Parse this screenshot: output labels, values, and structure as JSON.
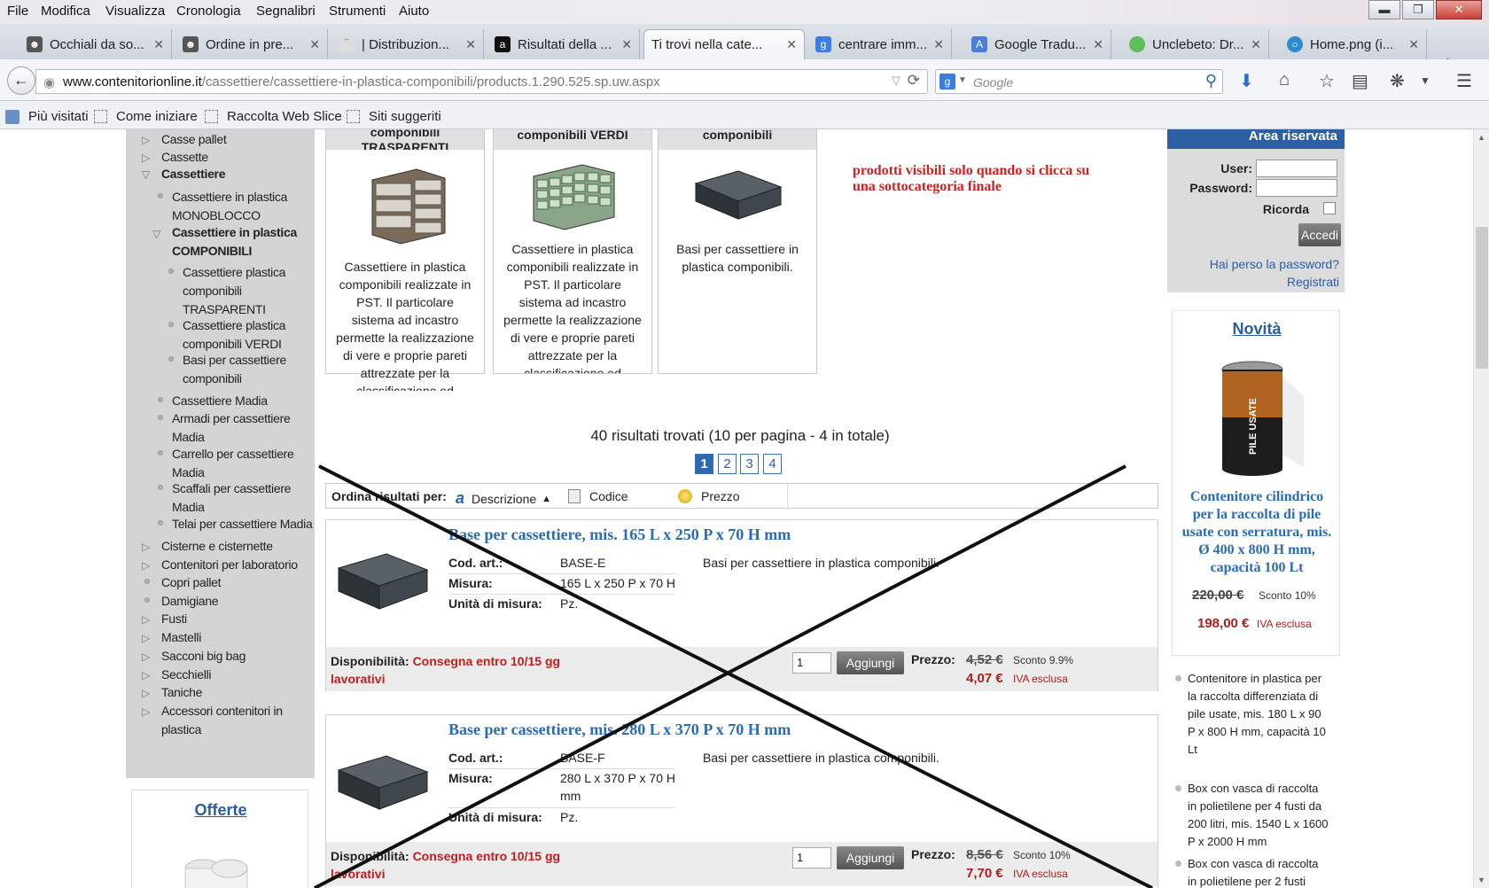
{
  "menubar": {
    "items": [
      "File",
      "Modifica",
      "Visualizza",
      "Cronologia",
      "Segnalibri",
      "Strumenti",
      "Aiuto"
    ]
  },
  "tabs": [
    {
      "label": "Occhiali da so...",
      "icon": "face-icon"
    },
    {
      "label": "Ordine in pre...",
      "icon": "face-icon"
    },
    {
      "label": "| Distribuzion...",
      "icon": "page-icon"
    },
    {
      "label": "Risultati della ...",
      "icon": "amazon-icon"
    },
    {
      "label": "Ti trovi nella cate...",
      "icon": "page-icon",
      "active": true
    },
    {
      "label": "centrare imm...",
      "icon": "google-icon"
    },
    {
      "label": "Google Tradu...",
      "icon": "translate-icon"
    },
    {
      "label": "Unclebeto: Dr...",
      "icon": "cloud-icon"
    },
    {
      "label": "Home.png (i...",
      "icon": "globe-icon"
    }
  ],
  "nav": {
    "url_domain": "www.contenitorionline.it",
    "url_path": "/cassettiere/cassettiere-in-plastica-componibili/products.1.290.525.sp.uw.aspx",
    "search_placeholder": "Google"
  },
  "bookmarks": [
    "Più visitati",
    "Come iniziare",
    "Raccolta Web Slice",
    "Siti suggeriti"
  ],
  "sidebar": {
    "items": [
      {
        "label": "Casse pallet",
        "type": "arrow"
      },
      {
        "label": "Cassette",
        "type": "arrow"
      },
      {
        "label": "Cassettiere",
        "type": "open",
        "selected": true
      },
      {
        "label": "Cassettiere in plastica MONOBLOCCO",
        "type": "dot"
      },
      {
        "label": "Cassettiere in plastica COMPONIBILI",
        "type": "open",
        "selected": true
      },
      {
        "label": "Cassettiere plastica componibili TRASPARENTI",
        "type": "dot"
      },
      {
        "label": "Cassettiere plastica componibili VERDI",
        "type": "dot"
      },
      {
        "label": "Basi per cassettiere componibili",
        "type": "dot"
      },
      {
        "label": "Cassettiere Madia",
        "type": "dot"
      },
      {
        "label": "Armadi per cassettiere Madia",
        "type": "dot"
      },
      {
        "label": "Carrello per cassettiere Madia",
        "type": "dot"
      },
      {
        "label": "Scaffali per cassettiere Madia",
        "type": "dot"
      },
      {
        "label": "Telai per cassettiere Madia",
        "type": "dot"
      },
      {
        "label": "Cisterne e cisternette",
        "type": "arrow"
      },
      {
        "label": "Contenitori per laboratorio",
        "type": "arrow"
      },
      {
        "label": "Copri pallet",
        "type": "dot"
      },
      {
        "label": "Damigiane",
        "type": "dot"
      },
      {
        "label": "Fusti",
        "type": "arrow"
      },
      {
        "label": "Mastelli",
        "type": "arrow"
      },
      {
        "label": "Sacconi big bag",
        "type": "arrow"
      },
      {
        "label": "Secchielli",
        "type": "arrow"
      },
      {
        "label": "Taniche",
        "type": "arrow"
      },
      {
        "label": "Accessori contenitori in plastica",
        "type": "arrow"
      }
    ],
    "offerte": "Offerte"
  },
  "subcategories": [
    {
      "title": "componibili TRASPARENTI",
      "desc": "Cassettiere in plastica componibili realizzate in PST. Il particolare sistema ad incastro permette la realizzazione di vere e proprie pareti attrezzate per la classificazione ed organizzazione di parti di"
    },
    {
      "title": "componibili VERDI",
      "desc": "Cassettiere in plastica componibili realizzate in PST. Il particolare sistema ad incastro permette la realizzazione di vere e proprie pareti attrezzate per la classificazione ed organizzazione di parti di"
    },
    {
      "title": "componibili",
      "desc": "Basi per cassettiere in plastica componibili."
    }
  ],
  "annotation": "prodotti visibili solo quando si clicca su una sottocategoria finale",
  "results": {
    "summary": "40 risultati trovati (10 per pagina - 4 in totale)",
    "pages": [
      "1",
      "2",
      "3",
      "4"
    ],
    "current_page": "1",
    "sort_label": "Ordina risultati per:",
    "sort_options": [
      "Descrizione",
      "Codice",
      "Prezzo"
    ]
  },
  "products": [
    {
      "title": "Base per cassettiere, mis. 165 L x 250 P x 70 H mm",
      "cod_label": "Cod. art.:",
      "cod": "BASE-E",
      "misura_label": "Misura:",
      "misura": "165 L x 250 P x 70 H",
      "unita_label": "Unità di misura:",
      "unita": "Pz.",
      "desc": "Basi per cassettiere in plastica componibili.",
      "disp_label": "Disponibilità:",
      "disp": "Consegna entro 10/15 gg lavorativi",
      "qty": "1",
      "add": "Aggiungi",
      "prezzo_label": "Prezzo:",
      "old_price": "4,52 €",
      "sconto": "Sconto 9.9%",
      "new_price": "4,07 €",
      "iva": "IVA esclusa"
    },
    {
      "title": "Base per cassettiere, mis. 280 L x 370 P x 70 H mm",
      "cod_label": "Cod. art.:",
      "cod": "BASE-F",
      "misura_label": "Misura:",
      "misura": "280 L x 370 P x 70 H mm",
      "unita_label": "Unità di misura:",
      "unita": "Pz.",
      "desc": "Basi per cassettiere in plastica componibili.",
      "disp_label": "Disponibilità:",
      "disp": "Consegna entro 10/15 gg lavorativi",
      "qty": "1",
      "add": "Aggiungi",
      "prezzo_label": "Prezzo:",
      "old_price": "8,56 €",
      "sconto": "Sconto 10%",
      "new_price": "7,70 €",
      "iva": "IVA esclusa"
    }
  ],
  "area": {
    "title": "Area riservata",
    "user_label": "User:",
    "password_label": "Password:",
    "ricorda_label": "Ricorda",
    "accedi": "Accedi",
    "lost": "Hai perso la password?",
    "register": "Registrati"
  },
  "novita": {
    "title": "Novità",
    "name": "Contenitore cilindrico per la raccolta di pile usate con serratura, mis. Ø 400 x 800 H mm, capacità 100 Lt",
    "old_price": "220,00 €",
    "sconto": "Sconto 10%",
    "new_price": "198,00 €",
    "iva": "IVA esclusa",
    "bin_label": "PILE USATE",
    "list": [
      "Contenitore in plastica per la raccolta differenziata di pile usate, mis. 180 L x 90 P x 800 H mm, capacità 10 Lt",
      "Box con vasca di raccolta in polietilene per 4 fusti da 200 litri, mis. 1540 L x 1600 P x 2000 H mm",
      "Box con vasca di raccolta in polietilene per 2 fusti"
    ]
  },
  "colors": {
    "link": "#2a5ea0",
    "price_red": "#b11b1b",
    "area_head": "#2c5fa3"
  }
}
